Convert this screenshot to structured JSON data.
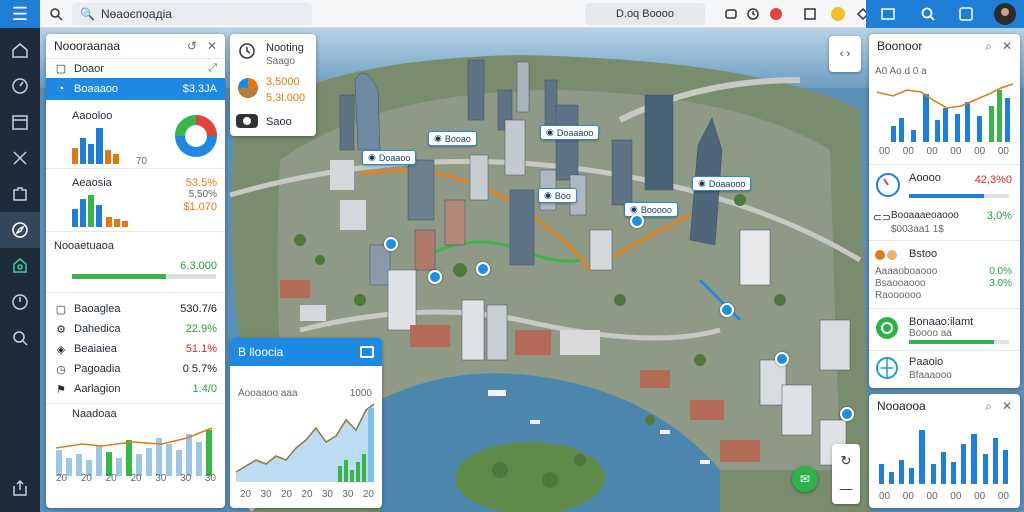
{
  "topbar": {
    "search_text": "Nөаоєпоадіа",
    "pill_text": "D.oq Boooo"
  },
  "left_panel": {
    "title": "Noooraanaa",
    "tab_top": "Doaoг",
    "tab_active": "Boaaaoo",
    "tab_active_value": "$3.3JA",
    "section1": {
      "label": "Aaooloo",
      "axis": "70"
    },
    "section2": {
      "label": "Aeaosia",
      "value1": "53.5%",
      "value2": "$1.070",
      "value0": "5,50%"
    },
    "progress": {
      "label": "Nooaetuaoa",
      "value": "6,3.000",
      "fill": 0.65
    },
    "stats": [
      {
        "label": "Baoaglea",
        "value": "530.7/6",
        "color": "d"
      },
      {
        "label": "Dahedica",
        "value": "22.9%",
        "color": "g"
      },
      {
        "label": "Beaiaiea",
        "value": "51.1%",
        "color": "r"
      },
      {
        "label": "Pagoadia",
        "value": "0 5.7%",
        "color": "d"
      },
      {
        "label": "Aarlagion",
        "value": "1.4/0",
        "color": "g"
      }
    ],
    "trend_label": "Naadoaa",
    "x_ticks": [
      "20",
      "20",
      "20",
      "20",
      "30",
      "30",
      "30"
    ]
  },
  "top_card": {
    "title": "Nooting",
    "subtitle": "Saago",
    "value1": "3,5000",
    "value2": "5,3l.000",
    "footer": "Saoo"
  },
  "chart_card": {
    "title": "B lloocia",
    "label": "Aooaaoo aaa",
    "right_value": "1000",
    "x_ticks": [
      "20",
      "30",
      "20",
      "20",
      "30",
      "30",
      "20"
    ]
  },
  "map_tags": [
    {
      "label": "Booao"
    },
    {
      "label": "Doaaoo"
    },
    {
      "label": "Doaaaoo"
    },
    {
      "label": "Boo"
    },
    {
      "label": "Doaaooo"
    },
    {
      "label": "Booooo"
    }
  ],
  "right_panel": {
    "title": "Boonoor",
    "sub": "A0 Ao.d 0 a",
    "x_ticks": [
      "00",
      "00",
      "00",
      "00",
      "00",
      "00"
    ],
    "items": [
      {
        "label": "Aoooo",
        "value": "42,3%0",
        "color": "r",
        "bar": 0.75
      },
      {
        "label": "Booaaaeoaooo",
        "value": "3,0%",
        "color": "g",
        "sub": "$003aa1 1$"
      },
      {
        "label": "Bstoo",
        "sub1": "Aaaaoboaooo",
        "sub2": "Bsaooaooo",
        "sub3": "Raoooooo",
        "val1": "0.0%",
        "val2": "3.0%"
      },
      {
        "label": "Bonaao:ilamt",
        "sub": "Boooo aa",
        "bar": 0.85
      },
      {
        "label": "Paaoio",
        "sub": "Bfaaaooo"
      }
    ]
  },
  "bottom_right": {
    "title": "Nooaooa",
    "x_ticks": [
      "00",
      "00",
      "00",
      "00",
      "00",
      "00"
    ]
  },
  "colors": {
    "accent": "#1f7fd6",
    "green": "#1e9e3e",
    "orange": "#e07a10",
    "red": "#d22222"
  }
}
